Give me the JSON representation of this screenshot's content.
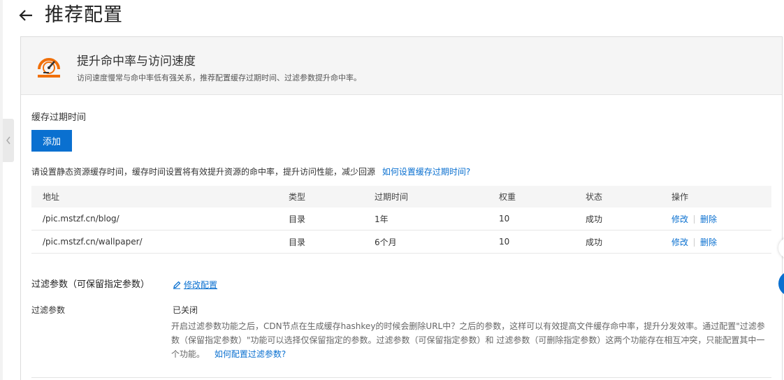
{
  "header": {
    "title": "推荐配置"
  },
  "banner": {
    "title": "提升命中率与访问速度",
    "description": "访问速度慢常与命中率低有强关系，推荐配置缓存过期时间、过滤参数提升命中率。"
  },
  "cache": {
    "section_label": "缓存过期时间",
    "add_label": "添加",
    "hint_text": "请设置静态资源缓存时间，缓存时间设置将有效提升资源的命中率，提升访问性能，减少回源",
    "hint_link": "如何设置缓存过期时间?",
    "columns": [
      "地址",
      "类型",
      "过期时间",
      "权重",
      "状态",
      "操作"
    ],
    "rows": [
      {
        "address": "/pic.mstzf.cn/blog/",
        "type": "目录",
        "expire": "1年",
        "weight": "10",
        "status": "成功",
        "edit": "修改",
        "delete": "删除"
      },
      {
        "address": "/pic.mstzf.cn/wallpaper/",
        "type": "目录",
        "expire": "6个月",
        "weight": "10",
        "status": "成功",
        "edit": "修改",
        "delete": "删除"
      }
    ]
  },
  "filter": {
    "title": "过滤参数（可保留指定参数）",
    "edit_label": "修改配置",
    "label": "过滤参数",
    "status": "已关闭",
    "description": "开启过滤参数功能之后，CDN节点在生成缓存hashkey的时候会删除URL中？之后的参数，这样可以有效提高文件缓存命中率，提升分发效率。通过配置\"过滤参数（保留指定参数）\"功能可以选择仅保留指定的参数。过滤参数（可保留指定参数）和 过滤参数（可删除指定参数）这两个功能存在相互冲突，只能配置其中一个功能。",
    "help_link": "如何配置过滤参数?"
  },
  "colors": {
    "accent": "#0a70d0",
    "icon_orange": "#f0700a"
  },
  "icons": [
    "back-arrow-icon",
    "speed-gauge-icon",
    "edit-pencil-icon",
    "chevron-left-icon"
  ]
}
